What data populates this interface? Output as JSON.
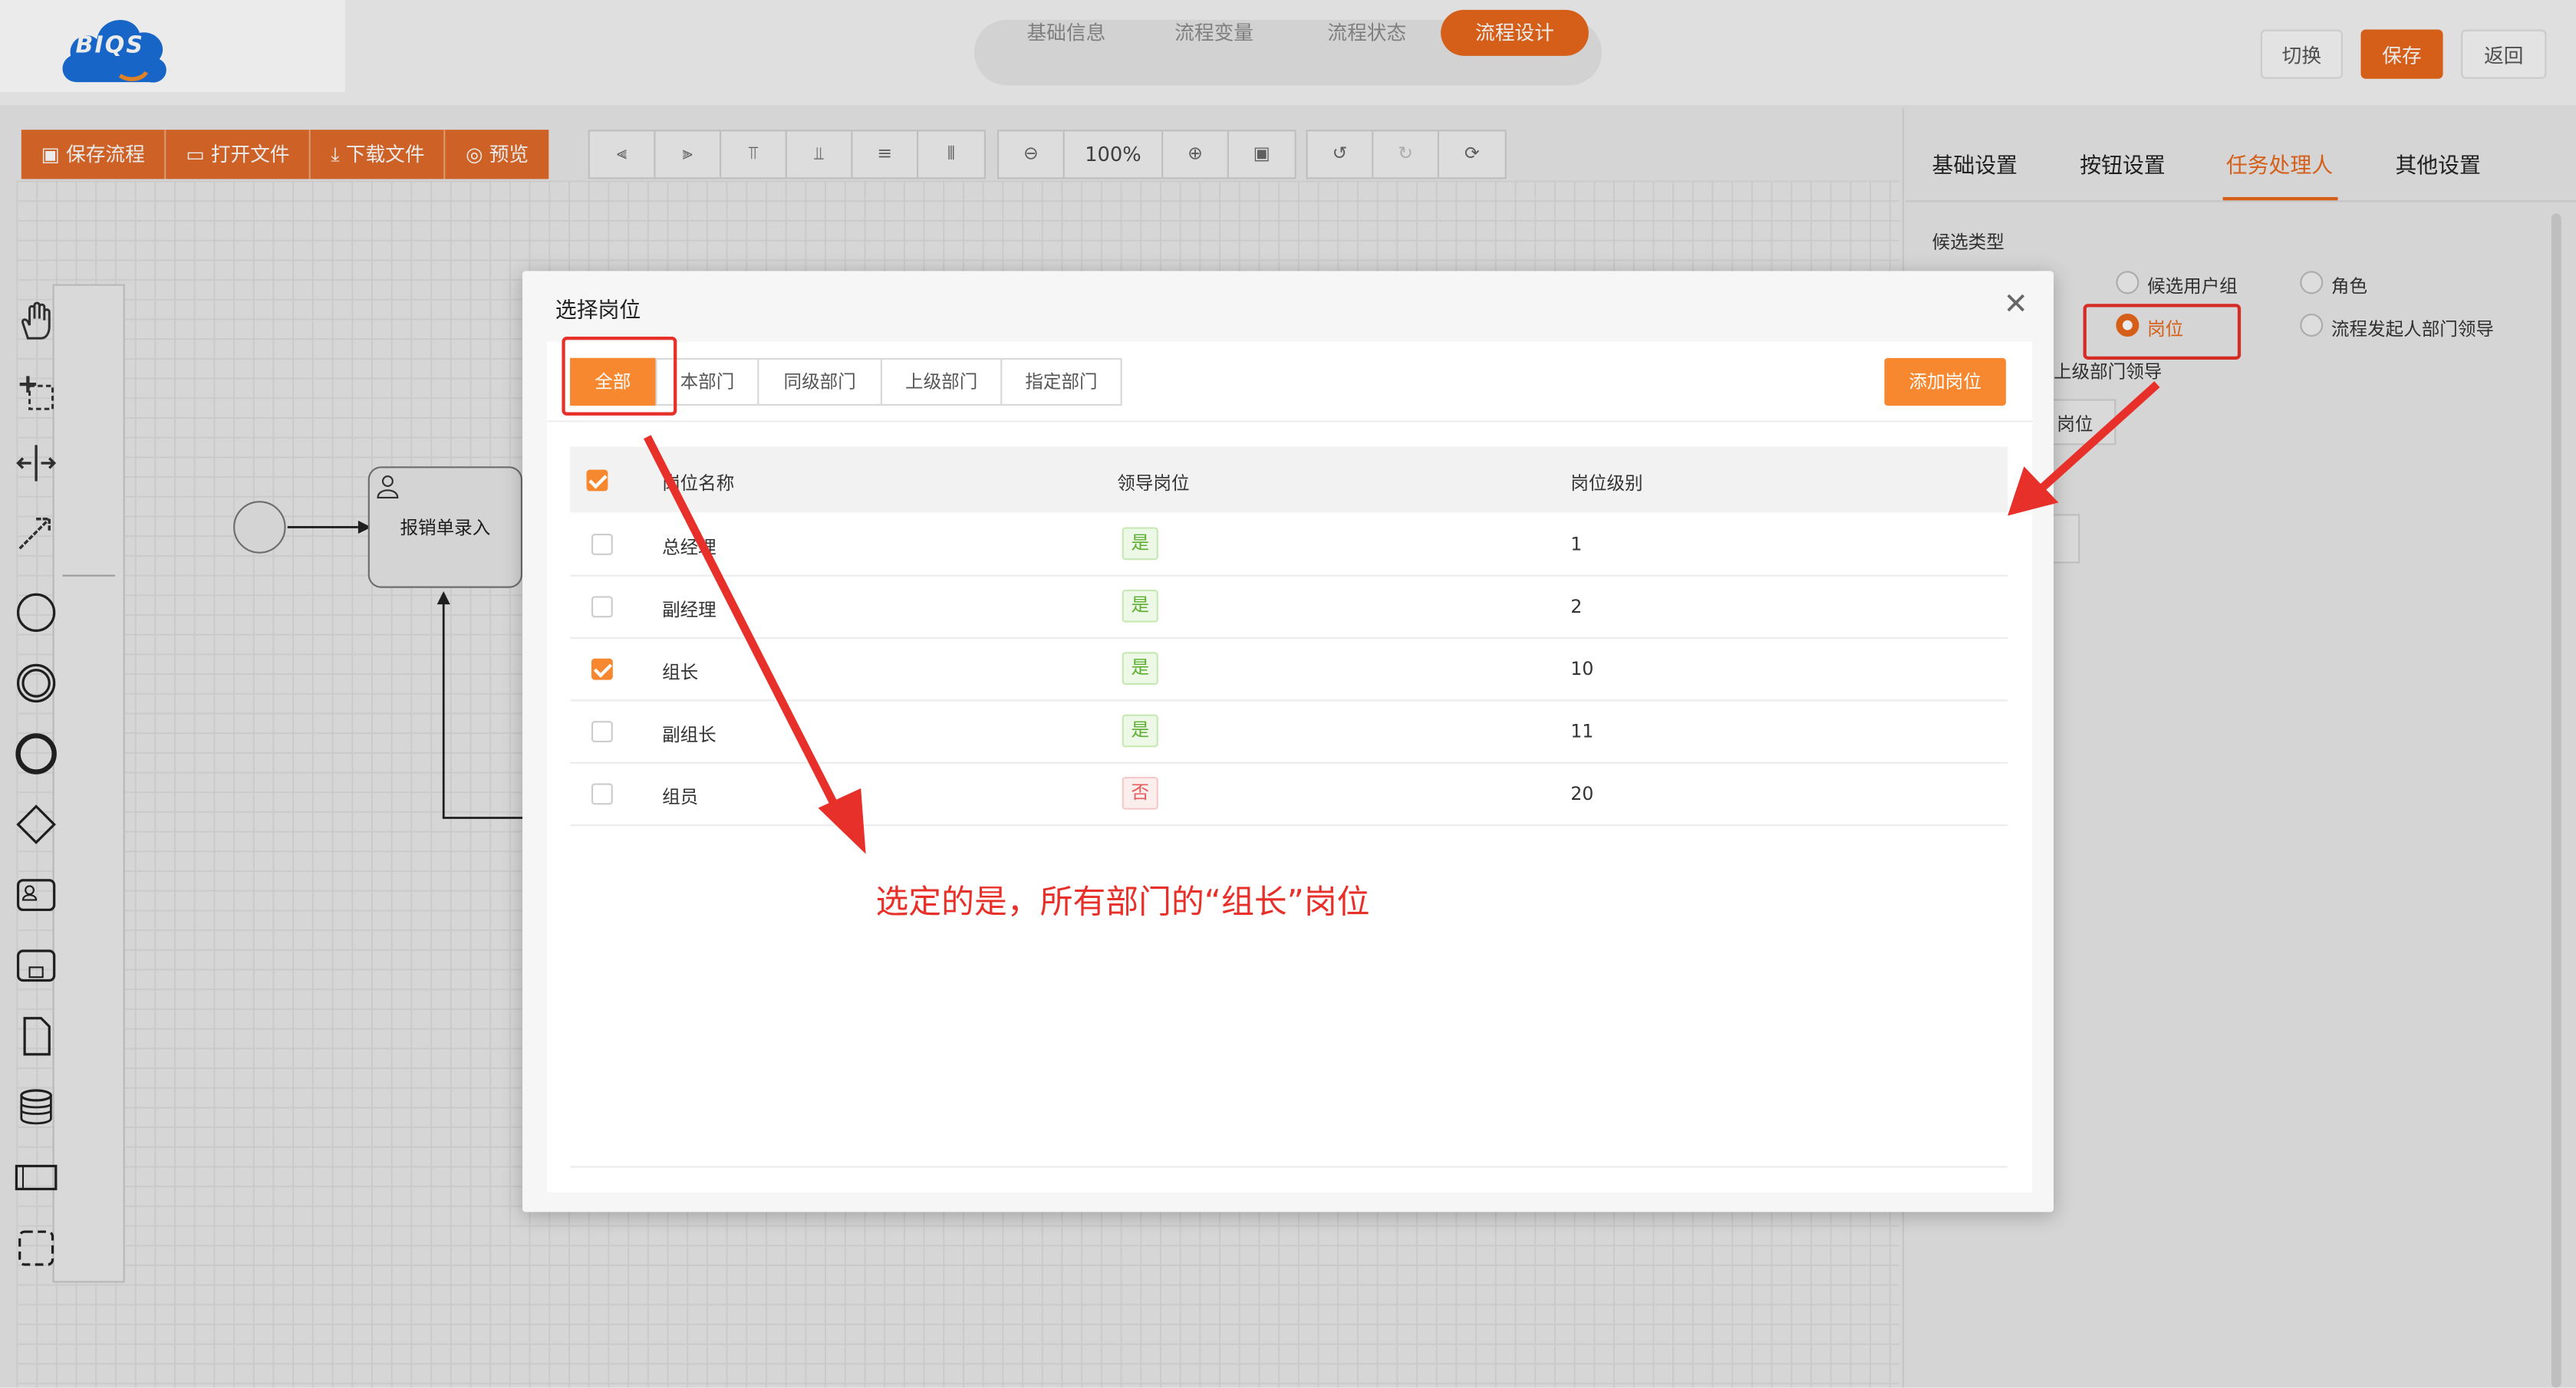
{
  "header": {
    "logo_text": "BIQS",
    "steps": [
      "基础信息",
      "流程变量",
      "流程状态",
      "流程设计"
    ],
    "active_step": "流程设计",
    "buttons": {
      "switch": "切换",
      "save": "保存",
      "back": "返回"
    }
  },
  "toolbar": {
    "actions": [
      "保存流程",
      "打开文件",
      "下载文件",
      "预览"
    ],
    "zoom": "100%"
  },
  "diagram": {
    "task_label": "报销单录入"
  },
  "right_panel": {
    "tabs": [
      "基础设置",
      "按钮设置",
      "任务处理人",
      "其他设置"
    ],
    "active_tab": "任务处理人",
    "candidate_type_label": "候选类型",
    "options": [
      "候选用户组",
      "角色",
      "岗位",
      "流程发起人部门领导"
    ],
    "selected_option": "岗位",
    "sub_label": "上级部门领导",
    "sub_value": "岗位"
  },
  "modal": {
    "title": "选择岗位",
    "filter_tabs": [
      "全部",
      "本部门",
      "同级部门",
      "上级部门",
      "指定部门"
    ],
    "active_filter": "全部",
    "add_button": "添加岗位",
    "columns": [
      "岗位名称",
      "领导岗位",
      "岗位级别"
    ],
    "rows": [
      {
        "name": "总经理",
        "leader": "是",
        "level": "1",
        "checked": false
      },
      {
        "name": "副经理",
        "leader": "是",
        "level": "2",
        "checked": false
      },
      {
        "name": "组长",
        "leader": "是",
        "level": "10",
        "checked": true
      },
      {
        "name": "副组长",
        "leader": "是",
        "level": "11",
        "checked": false
      },
      {
        "name": "组员",
        "leader": "否",
        "level": "20",
        "checked": false
      }
    ]
  },
  "annotation": {
    "text": "选定的是，所有部门的“组长”岗位",
    "color": "#e8302a"
  },
  "colors": {
    "accent": "#e8681c",
    "tab_active": "#f7882f"
  }
}
